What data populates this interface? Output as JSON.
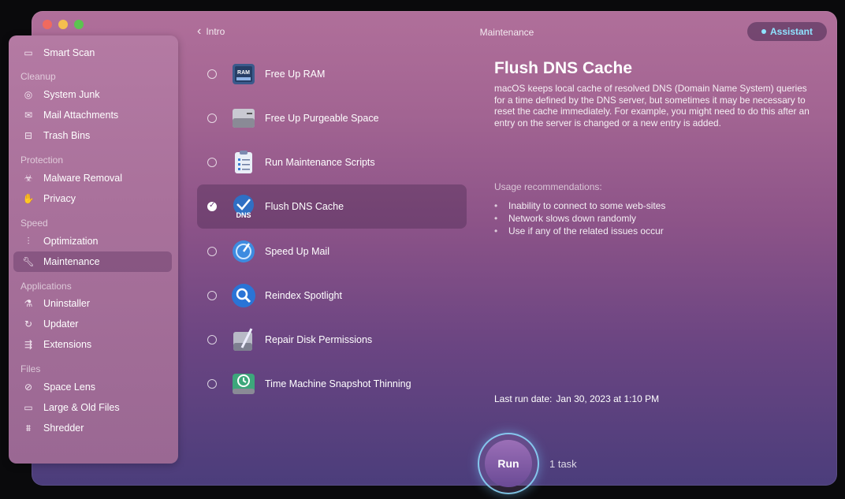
{
  "window": {
    "title": "Maintenance",
    "back_label": "Intro",
    "assistant_label": "Assistant"
  },
  "sidebar": {
    "top": [
      {
        "label": "Smart Scan",
        "icon": "monitor-icon"
      }
    ],
    "groups": [
      {
        "title": "Cleanup",
        "items": [
          {
            "label": "System Junk",
            "icon": "hard-disk-icon"
          },
          {
            "label": "Mail Attachments",
            "icon": "envelope-icon"
          },
          {
            "label": "Trash Bins",
            "icon": "trash-icon"
          }
        ]
      },
      {
        "title": "Protection",
        "items": [
          {
            "label": "Malware Removal",
            "icon": "biohazard-icon"
          },
          {
            "label": "Privacy",
            "icon": "hand-icon"
          }
        ]
      },
      {
        "title": "Speed",
        "items": [
          {
            "label": "Optimization",
            "icon": "sliders-icon"
          },
          {
            "label": "Maintenance",
            "icon": "wrench-icon",
            "active": true
          }
        ]
      },
      {
        "title": "Applications",
        "items": [
          {
            "label": "Uninstaller",
            "icon": "uninstaller-icon"
          },
          {
            "label": "Updater",
            "icon": "updater-icon"
          },
          {
            "label": "Extensions",
            "icon": "extensions-icon"
          }
        ]
      },
      {
        "title": "Files",
        "items": [
          {
            "label": "Space Lens",
            "icon": "lens-icon"
          },
          {
            "label": "Large & Old Files",
            "icon": "folder-icon"
          },
          {
            "label": "Shredder",
            "icon": "shredder-icon"
          }
        ]
      }
    ]
  },
  "tasks": [
    {
      "label": "Free Up RAM",
      "icon": "ram-icon",
      "icon_text": "RAM",
      "checked": false
    },
    {
      "label": "Free Up Purgeable Space",
      "icon": "drive-icon",
      "checked": false
    },
    {
      "label": "Run Maintenance Scripts",
      "icon": "clipboard-icon",
      "checked": false
    },
    {
      "label": "Flush DNS Cache",
      "icon": "dns-icon",
      "icon_text": "DNS",
      "checked": true
    },
    {
      "label": "Speed Up Mail",
      "icon": "mail-speed-icon",
      "checked": false
    },
    {
      "label": "Reindex Spotlight",
      "icon": "spotlight-icon",
      "checked": false
    },
    {
      "label": "Repair Disk Permissions",
      "icon": "disk-repair-icon",
      "checked": false
    },
    {
      "label": "Time Machine Snapshot Thinning",
      "icon": "time-machine-icon",
      "checked": false
    }
  ],
  "detail": {
    "title": "Flush DNS Cache",
    "description": "macOS keeps local cache of resolved DNS (Domain Name System) queries for a time defined by the DNS server, but sometimes it may be necessary to reset the cache immediately. For example, you might need to do this after an entry on the server is changed or a new entry is added.",
    "usage_title": "Usage recommendations:",
    "recommendations": [
      "Inability to connect to some web-sites",
      "Network slows down randomly",
      "Use if any of the related issues occur"
    ],
    "last_run_label": "Last run date:",
    "last_run_value": "Jan 30, 2023 at 1:10 PM"
  },
  "run": {
    "label": "Run",
    "count_label": "1 task"
  },
  "colors": {
    "accent": "#8fe3ff",
    "run_ring": "#8cdcff"
  }
}
